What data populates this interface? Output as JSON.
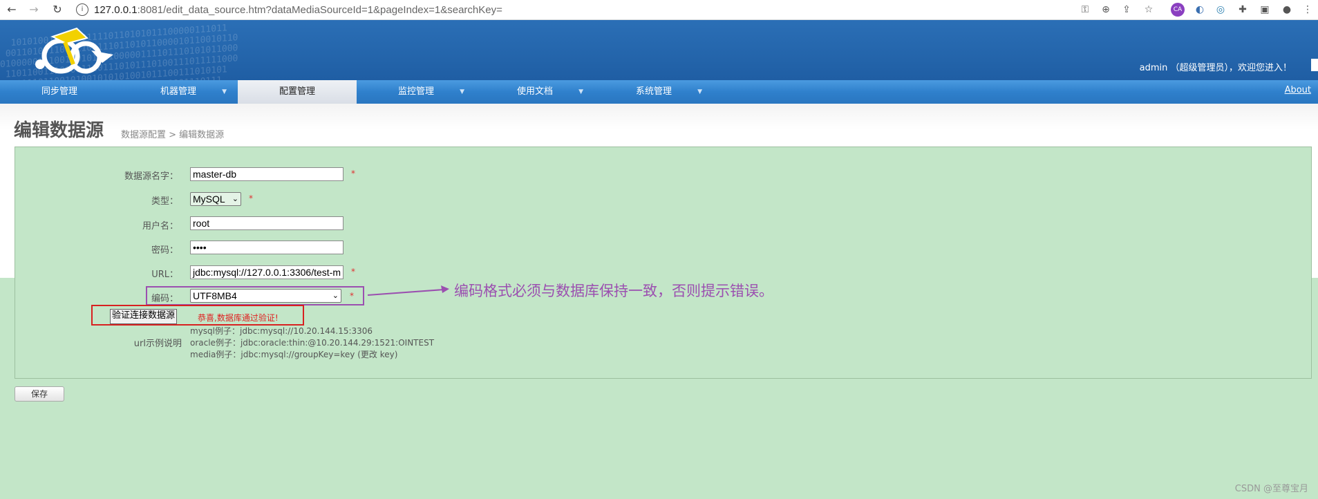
{
  "browser": {
    "url_host": "127.0.0.1",
    "url_path": ":8081/edit_data_source.htm?dataMediaSourceId=1&pageIndex=1&searchKey="
  },
  "header": {
    "welcome": "admin （超级管理员），欢迎您进入！"
  },
  "menu": {
    "items": [
      {
        "label": "同步管理"
      },
      {
        "label": "机器管理"
      },
      {
        "label": "配置管理"
      },
      {
        "label": "监控管理"
      },
      {
        "label": "使用文档"
      },
      {
        "label": "系统管理"
      }
    ],
    "active": "配置管理",
    "about": "About"
  },
  "page": {
    "title": "编辑数据源",
    "breadcrumb": "数据源配置 > 编辑数据源"
  },
  "form": {
    "name_label": "数据源名字：",
    "name_value": "master-db",
    "type_label": "类型：",
    "type_value": "MySQL",
    "user_label": "用户名：",
    "user_value": "root",
    "password_label": "密码：",
    "password_value": "••••",
    "url_label": "URL：",
    "url_value": "jdbc:mysql://127.0.0.1:3306/test-m",
    "encoding_label": "编码：",
    "encoding_value": "UTF8MB4",
    "required_mark": "*",
    "verify_button": "验证连接数据源",
    "verify_message": "恭喜,数据库通过验证!",
    "examples_label": "url示例说明",
    "examples": [
      "mysql例子：jdbc:mysql://10.20.144.15:3306",
      "oracle例子：jdbc:oracle:thin:@10.20.144.29:1521:OINTEST",
      "media例子：jdbc:mysql://groupKey=key (更改 key)"
    ],
    "save_button": "保存"
  },
  "annotation": "编码格式必须与数据库保持一致，否则提示错误。",
  "watermark": "CSDN @至尊宝月",
  "colors": {
    "annotation": "#9b4fb0",
    "highlight_red": "#d82020",
    "panel_bg": "#c3e6c8",
    "header_bg": "#2b6fb6",
    "menu_bg": "#2f80cc"
  }
}
